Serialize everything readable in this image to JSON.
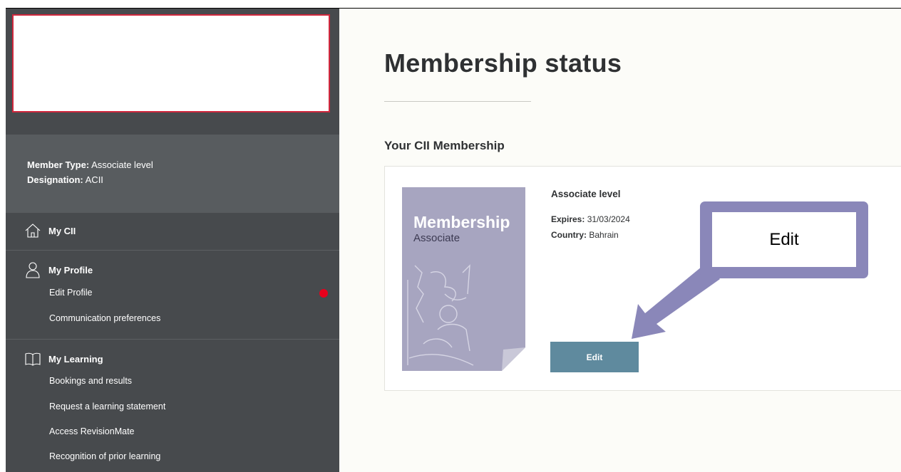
{
  "sidebar": {
    "member_type_label": "Member Type:",
    "member_type_value": "Associate level",
    "designation_label": "Designation:",
    "designation_value": "ACII",
    "sections": [
      {
        "icon": "home-icon",
        "label": "My CII",
        "items": []
      },
      {
        "icon": "person-icon",
        "label": "My Profile",
        "items": [
          "Edit Profile",
          "Communication preferences"
        ]
      },
      {
        "icon": "book-icon",
        "label": "My Learning",
        "items": [
          "Bookings and results",
          "Request a learning statement",
          "Access RevisionMate",
          "Recognition of prior learning"
        ]
      }
    ]
  },
  "main": {
    "page_title": "Membership status",
    "section_title": "Your CII Membership",
    "card": {
      "badge_title": "Membership",
      "badge_subtitle": "Associate",
      "level_name": "Associate level",
      "expires_label": "Expires:",
      "expires_value": "31/03/2024",
      "country_label": "Country:",
      "country_value": "Bahrain",
      "edit_label": "Edit"
    }
  },
  "annotation": {
    "callout_text": "Edit"
  },
  "colors": {
    "sidebar_bg": "#474a4d",
    "member_panel_bg": "#585c5f",
    "logo_border": "#d1273d",
    "notification_dot": "#e8001c",
    "badge_bg": "#a7a5c0",
    "edit_button": "#5f8a9e",
    "annotation": "#8a87b9"
  }
}
